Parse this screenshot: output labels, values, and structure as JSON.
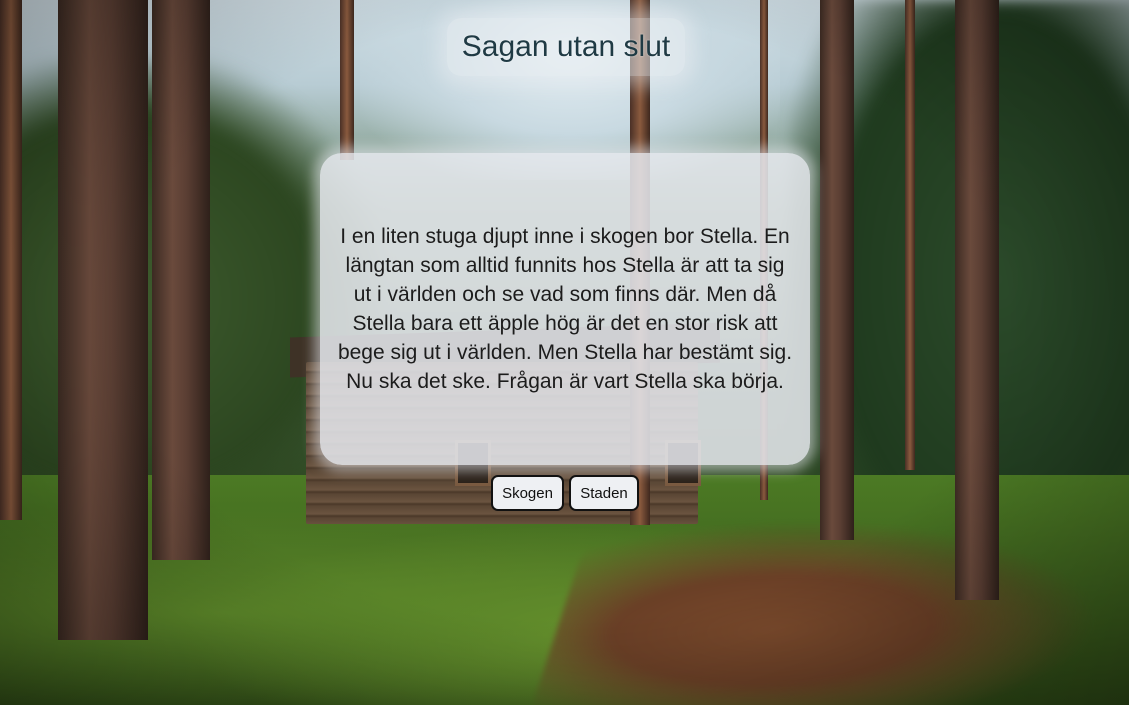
{
  "page": {
    "title": "Sagan utan slut"
  },
  "story": {
    "text": "I en liten stuga djupt inne i skogen bor Stella. En längtan som alltid funnits hos Stella är att ta sig ut i världen och se vad som finns där. Men då Stella bara ett äpple hög är det en stor risk att bege sig ut i världen. Men Stella har bestämt sig. Nu ska det ske. Frågan är vart Stella ska börja."
  },
  "choices": [
    {
      "label": "Skogen"
    },
    {
      "label": "Staden"
    }
  ],
  "background": {
    "scene": "forest-cabin-photo"
  }
}
